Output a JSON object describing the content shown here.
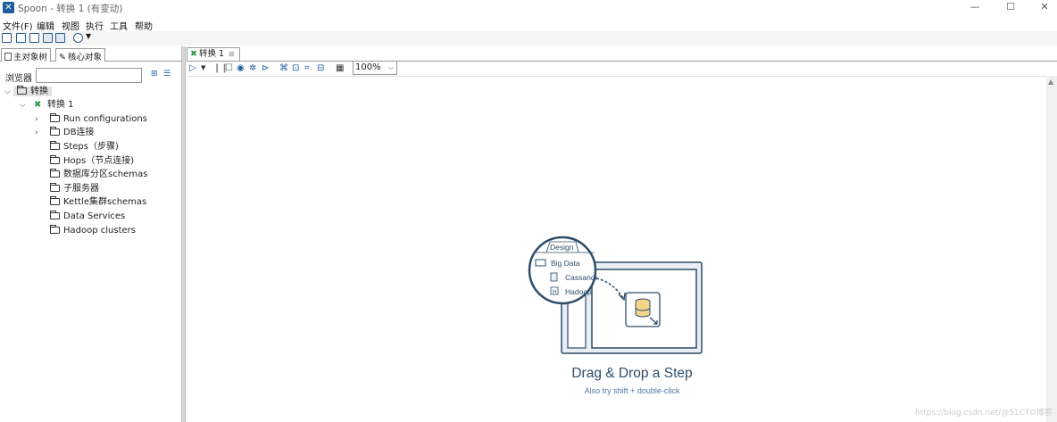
{
  "window": {
    "title": "Spoon - 转换 1 (有变动)"
  },
  "menu": [
    "文件(F)",
    "编辑",
    "视图",
    "执行",
    "工具",
    "帮助"
  ],
  "left_panel": {
    "tabs": [
      "主对象树",
      "核心对象"
    ],
    "browse_label": "浏览器",
    "tree_root": "转换",
    "transformation": "转换 1",
    "items": [
      "Run configurations",
      "DB连接",
      "Steps（步骤)",
      "Hops（节点连接)",
      "数据库分区schemas",
      "子服务器",
      "Kettle集群schemas",
      "Data Services",
      "Hadoop clusters"
    ]
  },
  "editor": {
    "tab_label": "转换 1",
    "zoom": "100%"
  },
  "canvas": {
    "design_tab": "Design",
    "folder_label": "Big Data",
    "step_items": [
      "Cassandr",
      "Hadoop"
    ],
    "drag_title": "Drag & Drop a Step",
    "drag_hint": "Also try shift + double-click"
  },
  "watermark": "https://blog.csdn.net/@51CTO博客",
  "colors": {
    "accent": "#1d5c9b",
    "canvas_art": "#2d4d6a",
    "transform_icon": "#2b9a4a"
  }
}
